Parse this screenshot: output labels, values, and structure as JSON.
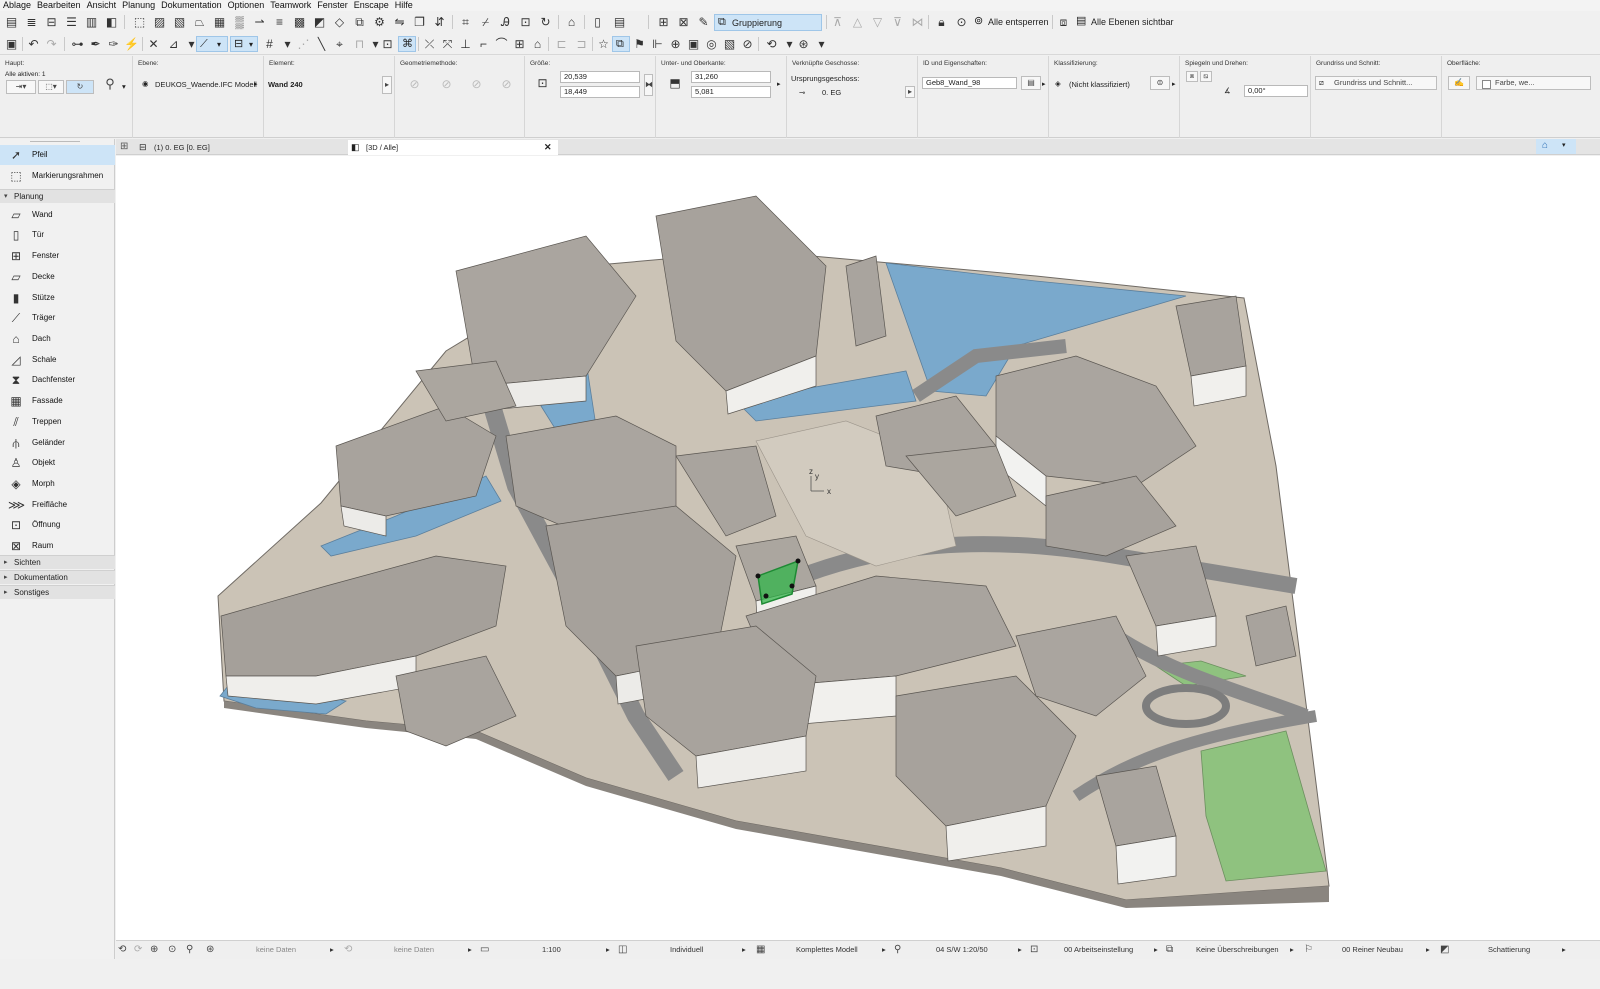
{
  "menu": [
    "Ablage",
    "Bearbeiten",
    "Ansicht",
    "Planung",
    "Dokumentation",
    "Optionen",
    "Teamwork",
    "Fenster",
    "Enscape",
    "Hilfe"
  ],
  "toolbar": {
    "suspend_groups": "Gruppierung aussetzen",
    "unlock_all": "Alle entsperren",
    "all_layers_visible": "Alle Ebenen sichtbar"
  },
  "infobox": {
    "haupt": {
      "label": "Haupt:",
      "sub": "Alle aktiven: 1"
    },
    "ebene": {
      "label": "Ebene:",
      "value": "DEUKOS_Waende.IFC Modell"
    },
    "element": {
      "label": "Element:",
      "value": "Wand 240"
    },
    "geometrie": {
      "label": "Geometriemethode:"
    },
    "groesse": {
      "label": "Größe:",
      "v1": "20,539",
      "v2": "18,449"
    },
    "kanten": {
      "label": "Unter- und Oberkante:",
      "v1": "31,260",
      "v2": "5,081"
    },
    "geschosse": {
      "label": "Verknüpfte Geschosse:",
      "sub": "Ursprungsgeschoss:",
      "value": "0. EG"
    },
    "id": {
      "label": "ID und Eigenschaften:",
      "value": "Geb8_Wand_98"
    },
    "klass": {
      "label": "Klassifizierung:",
      "value": "(Nicht klassifiziert)"
    },
    "spiegeln": {
      "label": "Spiegeln und Drehen:",
      "value": "0,00°"
    },
    "grundriss": {
      "label": "Grundriss und Schnitt:",
      "value": "Grundriss und Schnitt..."
    },
    "oberflaeche": {
      "label": "Oberfläche:",
      "value": "Farbe, we..."
    }
  },
  "toolbox": {
    "arrow": "Pfeil",
    "marquee": "Markierungsrahmen",
    "planung": "Planung",
    "tools": [
      "Wand",
      "Tür",
      "Fenster",
      "Decke",
      "Stütze",
      "Träger",
      "Dach",
      "Schale",
      "Dachfenster",
      "Fassade",
      "Treppen",
      "Geländer",
      "Objekt",
      "Morph",
      "Freifläche",
      "Öffnung",
      "Raum"
    ],
    "groups": [
      "Sichten",
      "Dokumentation",
      "Sonstiges"
    ]
  },
  "tabs": {
    "floorplan": "(1) 0. EG [0. EG]",
    "view3d": "[3D / Alle]"
  },
  "viewport": {
    "axis_z": "z",
    "axis_y": "y",
    "axis_x": "x"
  },
  "status": {
    "nodata1": "keine Daten",
    "nodata2": "keine Daten",
    "scale": "1:100",
    "layers": "Individuell",
    "model": "Komplettes Modell",
    "pen": "04 S/W 1:20/50",
    "mvo": "00 Arbeitseinstellung",
    "overrides": "Keine Überschreibungen",
    "renovation": "00 Reiner Neubau",
    "shading": "Schattierung"
  },
  "colors": {
    "selection": "#32b44a",
    "water": "#7aa9cc",
    "ground": "#cbc3b6",
    "street": "#8a8a8a",
    "roof": "#aaa59f",
    "wall": "#f2f2f0",
    "green": "#8fc27f",
    "highlight": "#cde4f7"
  }
}
